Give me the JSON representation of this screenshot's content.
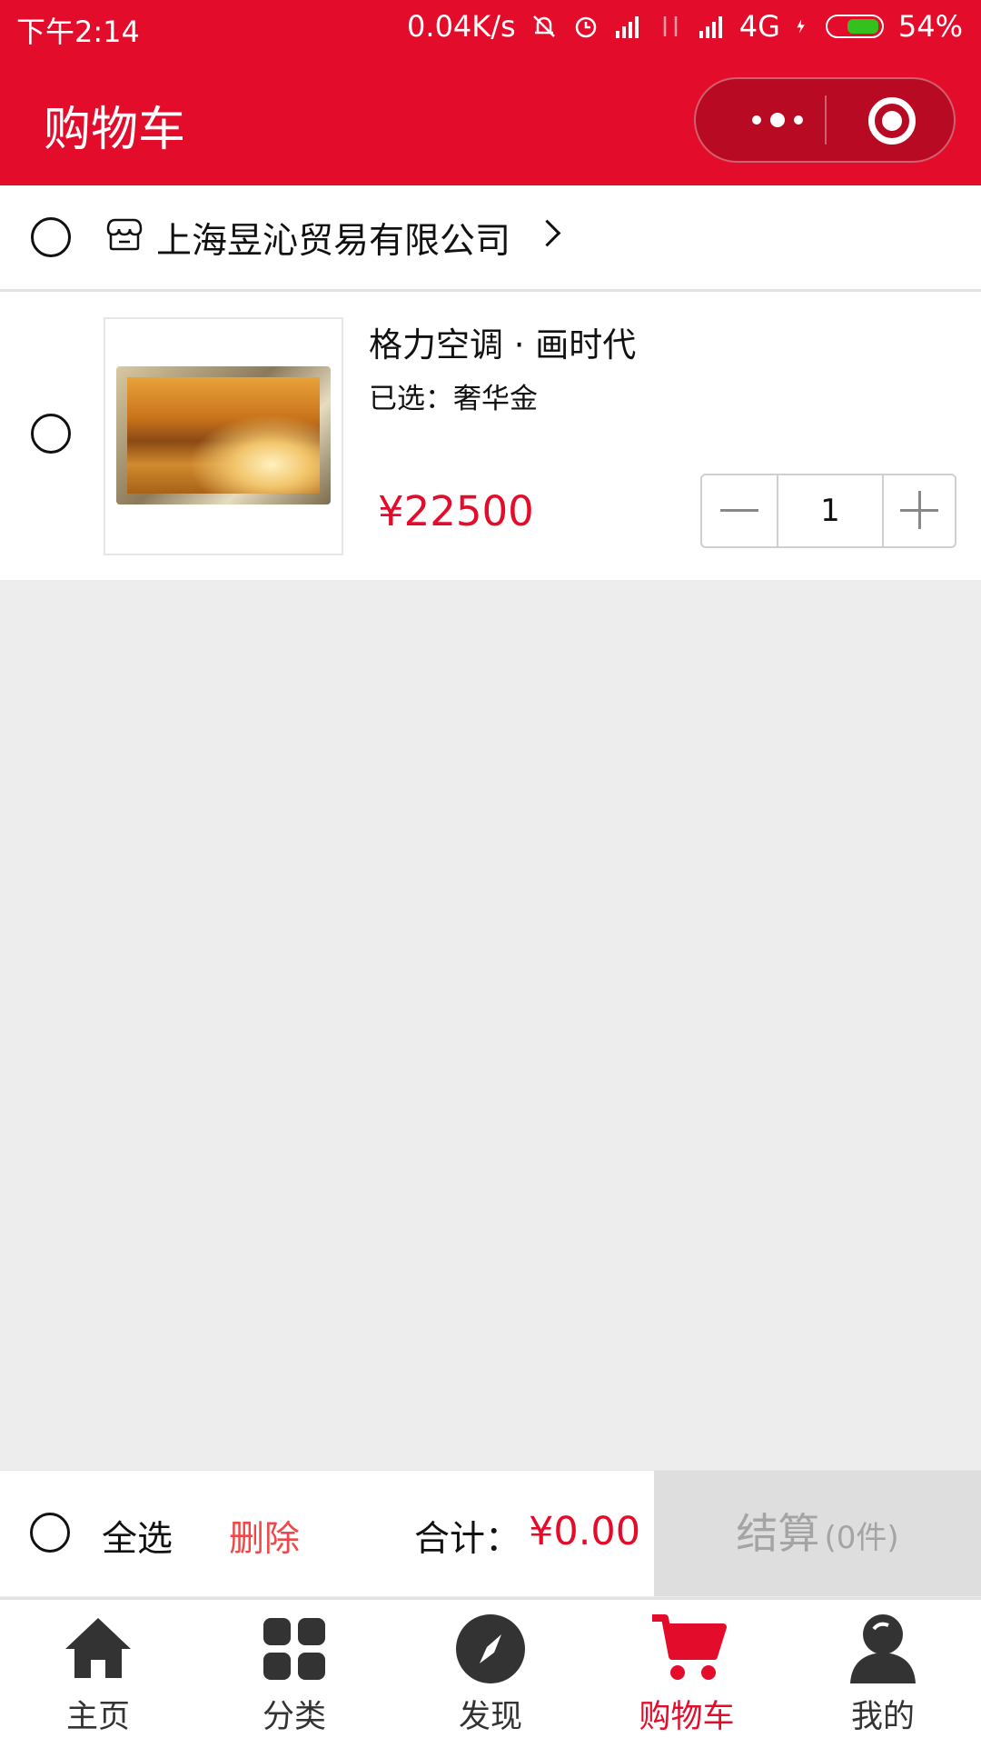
{
  "status_bar": {
    "time": "下午2:14",
    "net_speed": "0.04K/s",
    "network": "4G",
    "battery": "54%",
    "battery_level": 0.54,
    "icons": [
      "mute-bell-icon",
      "alarm-icon",
      "signal-icon",
      "data-arrows-icon",
      "signal-icon",
      "charging-icon",
      "battery-icon"
    ]
  },
  "header": {
    "title": "购物车",
    "more_icon": "more-dots-icon",
    "close_icon": "target-icon"
  },
  "store": {
    "name": "上海昱沁贸易有限公司",
    "icon": "shop-icon"
  },
  "item": {
    "name": "格力空调 · 画时代",
    "spec": "已选：奢华金",
    "price": "¥22500",
    "quantity": "1"
  },
  "checkout": {
    "select_all": "全选",
    "delete": "删除",
    "total_label": "合计：",
    "total_value": "¥0.00",
    "submit": "结算",
    "count": "(0件)"
  },
  "tabbar": {
    "items": [
      {
        "label": "主页",
        "icon": "home-icon"
      },
      {
        "label": "分类",
        "icon": "grid-icon"
      },
      {
        "label": "发现",
        "icon": "compass-icon"
      },
      {
        "label": "购物车",
        "icon": "cart-icon"
      },
      {
        "label": "我的",
        "icon": "user-icon"
      }
    ],
    "active_index": 3
  },
  "colors": {
    "brand_red": "#e40c2b",
    "price_red": "#e40c2b",
    "delete_red": "#f04848",
    "disabled_gray": "#dedede"
  }
}
